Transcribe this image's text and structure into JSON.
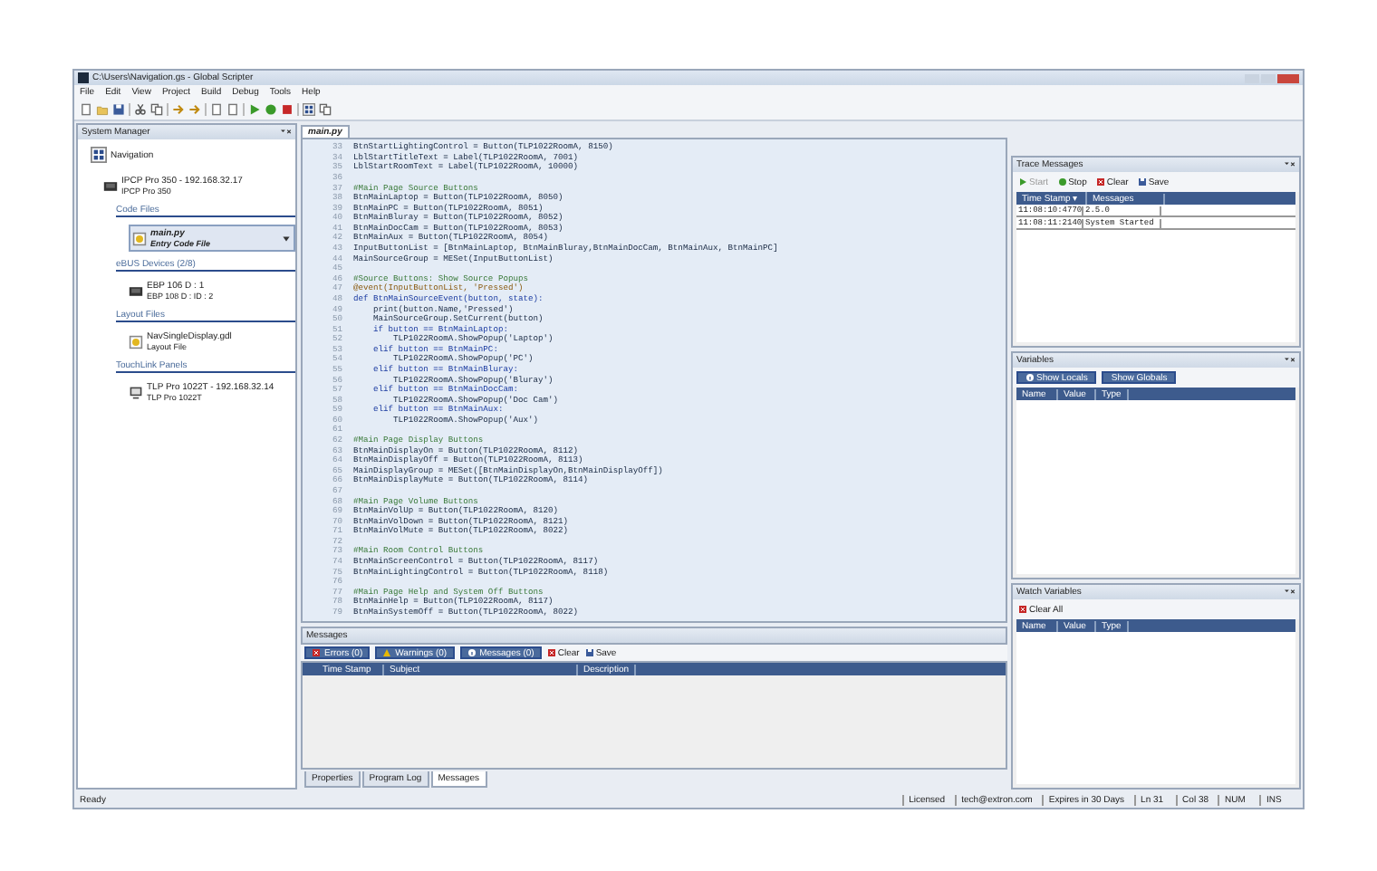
{
  "window": {
    "title": "C:\\Users\\Navigation.gs - Global Scripter"
  },
  "menu": [
    "File",
    "Edit",
    "View",
    "Project",
    "Build",
    "Debug",
    "Tools",
    "Help"
  ],
  "system_manager": {
    "title": "System Manager",
    "tree": [
      {
        "label": "Navigation",
        "kind": "project",
        "selected": false,
        "children": [
          {
            "label": "IPCP Pro 350 - 192.168.32.17",
            "sublabel": "IPCP Pro 350",
            "kind": "device",
            "selected": false,
            "children": [
              {
                "label": "Code Files",
                "kind": "group",
                "selected": false,
                "children": [
                  {
                    "label": "main.py",
                    "sublabel": "Entry Code File",
                    "kind": "file",
                    "selected": true
                  }
                ]
              },
              {
                "label": "eBUS Devices (2/8)",
                "kind": "group",
                "selected": false,
                "children": [
                  {
                    "label": "EBP 106 D : 1",
                    "sublabel": "EBP 108 D : ID : 2",
                    "kind": "device",
                    "selected": false
                  }
                ]
              },
              {
                "label": "Layout Files",
                "kind": "group",
                "selected": false,
                "children": [
                  {
                    "label": "NavSingleDisplay.gdl",
                    "sublabel": "Layout File",
                    "kind": "file",
                    "selected": false
                  }
                ]
              },
              {
                "label": "TouchLink Panels",
                "kind": "group",
                "selected": false,
                "children": [
                  {
                    "label": "TLP Pro 1022T - 192.168.32.14",
                    "sublabel": "TLP Pro 1022T",
                    "kind": "device",
                    "selected": false
                  }
                ]
              }
            ]
          }
        ]
      }
    ]
  },
  "editor": {
    "tab": "main.py",
    "lines": [
      {
        "number": "33",
        "kind": "code",
        "text": "BtnStartLightingControl = Button(TLP1022RoomA, 8150)"
      },
      {
        "number": "34",
        "kind": "code",
        "text": "LblStartTitleText = Label(TLP1022RoomA, 7001)"
      },
      {
        "number": "35",
        "kind": "code",
        "text": "LblStartRoomText = Label(TLP1022RoomA, 10000)"
      },
      {
        "number": "36",
        "kind": "blank"
      },
      {
        "number": "37",
        "kind": "comment",
        "text": "#Main Page Source Buttons"
      },
      {
        "number": "38",
        "kind": "code",
        "text": "BtnMainLaptop = Button(TLP1022RoomA, 8050)"
      },
      {
        "number": "39",
        "kind": "code",
        "text": "BtnMainPC = Button(TLP1022RoomA, 8051)"
      },
      {
        "number": "40",
        "kind": "code",
        "text": "BtnMainBluray = Button(TLP1022RoomA, 8052)"
      },
      {
        "number": "41",
        "kind": "code",
        "text": "BtnMainDocCam = Button(TLP1022RoomA, 8053)"
      },
      {
        "number": "42",
        "kind": "code",
        "text": "BtnMainAux = Button(TLP1022RoomA, 8054)"
      },
      {
        "number": "43",
        "kind": "code",
        "text": "InputButtonList = [BtnMainLaptop, BtnMainBluray,BtnMainDocCam, BtnMainAux, BtnMainPC]"
      },
      {
        "number": "44",
        "kind": "code",
        "text": "MainSourceGroup = MESet(InputButtonList)"
      },
      {
        "number": "45",
        "kind": "blank"
      },
      {
        "number": "46",
        "kind": "comment",
        "text": "#Source Buttons: Show Source Popups"
      },
      {
        "number": "47",
        "kind": "decorator",
        "text": "@event(InputButtonList, 'Pressed')"
      },
      {
        "number": "48",
        "kind": "keyword",
        "text": "def BtnMainSourceEvent(button, state):"
      },
      {
        "number": "49",
        "kind": "code",
        "text": "    print(button.Name,'Pressed')"
      },
      {
        "number": "50",
        "kind": "code",
        "text": "    MainSourceGroup.SetCurrent(button)"
      },
      {
        "number": "51",
        "kind": "keyword",
        "text": "    if button == BtnMainLaptop:"
      },
      {
        "number": "52",
        "kind": "code",
        "text": "        TLP1022RoomA.ShowPopup('Laptop')"
      },
      {
        "number": "53",
        "kind": "keyword",
        "text": "    elif button == BtnMainPC:"
      },
      {
        "number": "54",
        "kind": "code",
        "text": "        TLP1022RoomA.ShowPopup('PC')"
      },
      {
        "number": "55",
        "kind": "keyword",
        "text": "    elif button == BtnMainBluray:"
      },
      {
        "number": "56",
        "kind": "code",
        "text": "        TLP1022RoomA.ShowPopup('Bluray')"
      },
      {
        "number": "57",
        "kind": "keyword",
        "text": "    elif button == BtnMainDocCam:"
      },
      {
        "number": "58",
        "kind": "code",
        "text": "        TLP1022RoomA.ShowPopup('Doc Cam')"
      },
      {
        "number": "59",
        "kind": "keyword",
        "text": "    elif button == BtnMainAux:"
      },
      {
        "number": "60",
        "kind": "code",
        "text": "        TLP1022RoomA.ShowPopup('Aux')"
      },
      {
        "number": "61",
        "kind": "blank"
      },
      {
        "number": "62",
        "kind": "comment",
        "text": "#Main Page Display Buttons"
      },
      {
        "number": "63",
        "kind": "code",
        "text": "BtnMainDisplayOn = Button(TLP1022RoomA, 8112)"
      },
      {
        "number": "64",
        "kind": "code",
        "text": "BtnMainDisplayOff = Button(TLP1022RoomA, 8113)"
      },
      {
        "number": "65",
        "kind": "code",
        "text": "MainDisplayGroup = MESet([BtnMainDisplayOn,BtnMainDisplayOff])"
      },
      {
        "number": "66",
        "kind": "code",
        "text": "BtnMainDisplayMute = Button(TLP1022RoomA, 8114)"
      },
      {
        "number": "67",
        "kind": "blank"
      },
      {
        "number": "68",
        "kind": "comment",
        "text": "#Main Page Volume Buttons"
      },
      {
        "number": "69",
        "kind": "code",
        "text": "BtnMainVolUp = Button(TLP1022RoomA, 8120)"
      },
      {
        "number": "70",
        "kind": "code",
        "text": "BtnMainVolDown = Button(TLP1022RoomA, 8121)"
      },
      {
        "number": "71",
        "kind": "code",
        "text": "BtnMainVolMute = Button(TLP1022RoomA, 8022)"
      },
      {
        "number": "72",
        "kind": "blank"
      },
      {
        "number": "73",
        "kind": "comment",
        "text": "#Main Room Control Buttons"
      },
      {
        "number": "74",
        "kind": "code",
        "text": "BtnMainScreenControl = Button(TLP1022RoomA, 8117)"
      },
      {
        "number": "75",
        "kind": "code",
        "text": "BtnMainLightingControl = Button(TLP1022RoomA, 8118)"
      },
      {
        "number": "76",
        "kind": "blank"
      },
      {
        "number": "77",
        "kind": "comment",
        "text": "#Main Page Help and System Off Buttons"
      },
      {
        "number": "78",
        "kind": "code",
        "text": "BtnMainHelp = Button(TLP1022RoomA, 8117)"
      },
      {
        "number": "79",
        "kind": "code",
        "text": "BtnMainSystemOff = Button(TLP1022RoomA, 8022)"
      }
    ]
  },
  "messages": {
    "title": "Messages",
    "filters": [
      {
        "label": "Errors (0)",
        "kind": "error"
      },
      {
        "label": "Warnings (0)",
        "kind": "warning"
      },
      {
        "label": "Messages (0)",
        "kind": "info"
      }
    ],
    "actions": [
      {
        "label": "Clear",
        "kind": "clear"
      },
      {
        "label": "Save",
        "kind": "save"
      }
    ],
    "columns": [
      "Time Stamp",
      "Subject",
      "Description"
    ],
    "tabs": [
      {
        "label": "Properties",
        "selected": false
      },
      {
        "label": "Program Log",
        "selected": false
      },
      {
        "label": "Messages",
        "selected": true
      }
    ]
  },
  "trace_messages": {
    "title": "Trace Messages",
    "actions": [
      {
        "label": "Start",
        "kind": "start",
        "disabled": true
      },
      {
        "label": "Stop",
        "kind": "stop",
        "disabled": false
      },
      {
        "label": "Clear",
        "kind": "clear",
        "disabled": false
      },
      {
        "label": "Save",
        "kind": "save",
        "disabled": false
      }
    ],
    "columns": [
      "Time Stamp ▾",
      "Messages"
    ],
    "rows": [
      [
        "11:08:10:4770",
        "2.5.0"
      ],
      [
        "11:08:11:2140",
        "System Started"
      ]
    ]
  },
  "variables": {
    "title": "Variables",
    "actions": [
      {
        "label": "Show Locals",
        "kind": "locals"
      },
      {
        "label": "Show Globals",
        "kind": "globals"
      }
    ],
    "columns": [
      "Name",
      "Value",
      "Type"
    ]
  },
  "watch_variables": {
    "title": "Watch Variables",
    "actions": [
      {
        "label": "Clear All",
        "kind": "clear"
      }
    ],
    "columns": [
      "Name",
      "Value",
      "Type"
    ]
  },
  "status_bar": {
    "left": "Ready",
    "fields": [
      "Licensed",
      "tech@extron.com",
      "Expires in 30 Days",
      "Ln 31",
      "Col 38",
      "NUM",
      "INS"
    ]
  }
}
